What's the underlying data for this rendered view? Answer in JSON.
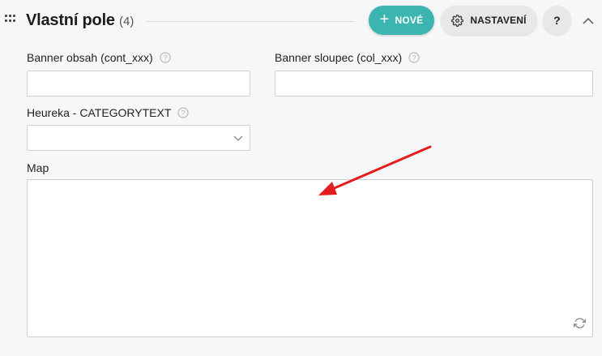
{
  "header": {
    "title": "Vlastní pole",
    "count": "(4)",
    "new_label": "NOVÉ",
    "new_icon": "plus-icon",
    "settings_label": "NASTAVENÍ",
    "settings_icon": "gear-icon",
    "help_label": "?",
    "collapse_icon": "chevron-up-icon"
  },
  "fields": {
    "banner_obsah": {
      "label": "Banner obsah (cont_xxx)",
      "value": ""
    },
    "banner_sloupec": {
      "label": "Banner sloupec (col_xxx)",
      "value": ""
    },
    "heureka": {
      "label": "Heureka - CATEGORYTEXT",
      "value": ""
    },
    "map": {
      "label": "Map",
      "value": ""
    }
  },
  "colors": {
    "accent": "#3cb5b0",
    "annotation_arrow": "#e31c1c",
    "background": "#f6f7f8"
  }
}
